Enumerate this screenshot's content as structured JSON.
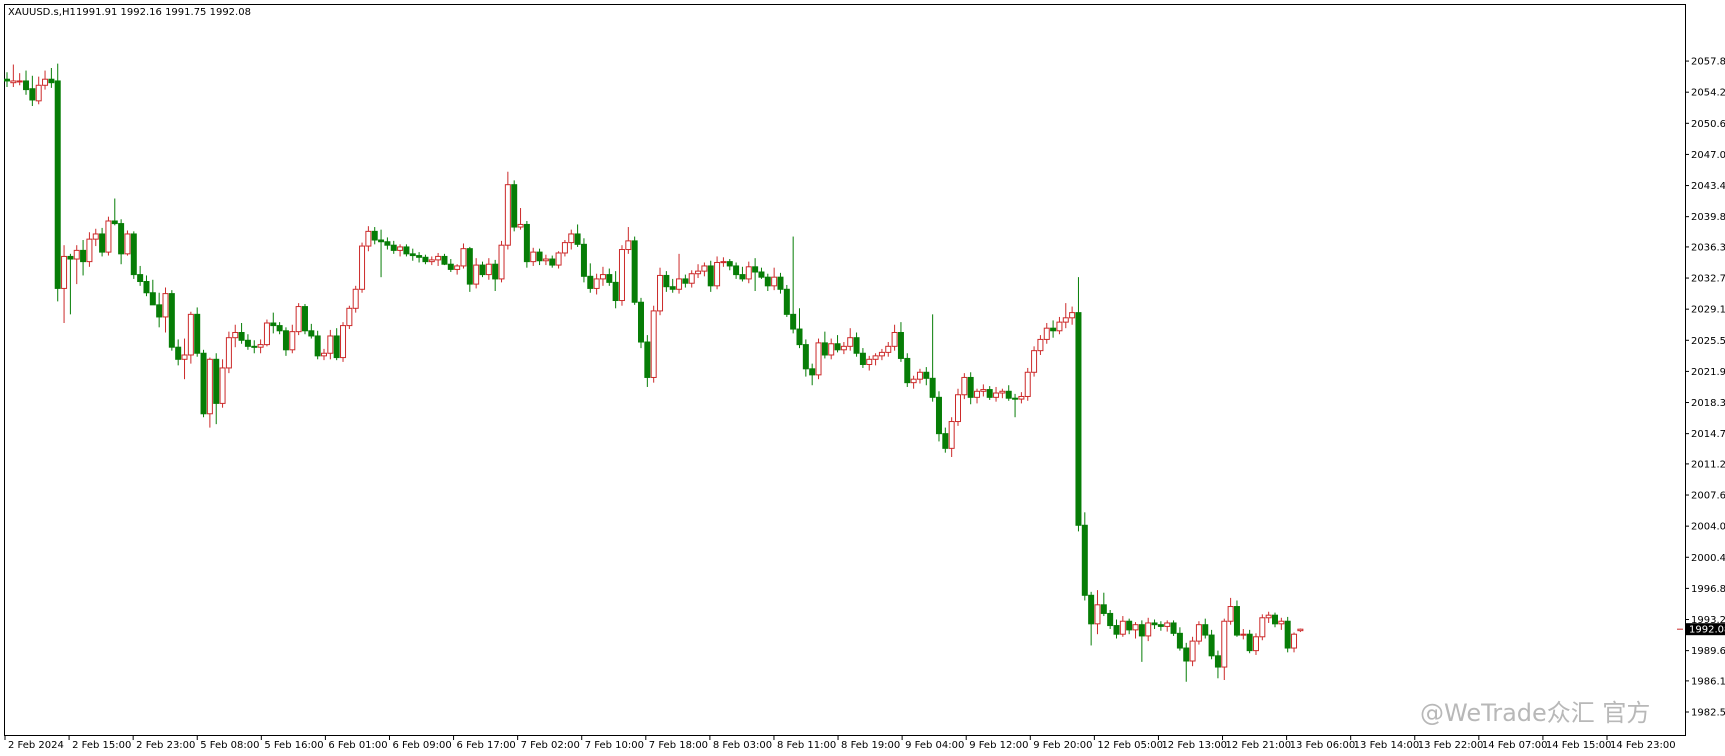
{
  "header": {
    "symbol_label": "XAUUSD.s,H1",
    "ohlc_label": "1991.91 1992.16 1991.75 1992.08"
  },
  "watermark": {
    "text": "@WeTrade众汇 官方"
  },
  "colors": {
    "background": "#ffffff",
    "bull": "#cc2a2a",
    "bear": "#067d06",
    "axis": "#000000",
    "price_tag_bg": "#000000",
    "price_tag_text": "#ffffff"
  },
  "chart_data": {
    "type": "candlestick",
    "title": "XAUUSD.s,H1",
    "timeframe": "H1",
    "grid": false,
    "ylim": [
      1982.5,
      2060.7
    ],
    "y_ticks": [
      "2057.80",
      "2054.20",
      "2050.60",
      "2047.00",
      "2043.40",
      "2039.80",
      "2036.30",
      "2032.70",
      "2029.10",
      "2025.50",
      "2021.90",
      "2018.30",
      "2014.70",
      "2011.20",
      "2007.60",
      "2004.00",
      "2000.40",
      "1996.80",
      "1993.20",
      "1989.60",
      "1986.10",
      "1982.50"
    ],
    "x_labels": [
      "2 Feb 2024",
      "2 Feb 15:00",
      "2 Feb 23:00",
      "5 Feb 08:00",
      "5 Feb 16:00",
      "6 Feb 01:00",
      "6 Feb 09:00",
      "6 Feb 17:00",
      "7 Feb 02:00",
      "7 Feb 10:00",
      "7 Feb 18:00",
      "8 Feb 03:00",
      "8 Feb 11:00",
      "8 Feb 19:00",
      "9 Feb 04:00",
      "9 Feb 12:00",
      "9 Feb 20:00",
      "12 Feb 05:00",
      "12 Feb 13:00",
      "12 Feb 21:00",
      "13 Feb 06:00",
      "13 Feb 14:00",
      "13 Feb 22:00",
      "14 Feb 07:00",
      "14 Feb 15:00",
      "14 Feb 23:00"
    ],
    "current_price": "1992.08",
    "candles": [
      [
        2055.7,
        2056.5,
        2054.8,
        2055.5
      ],
      [
        2055.3,
        2057.4,
        2054.8,
        2055.5
      ],
      [
        2055.4,
        2056.4,
        2055.0,
        2055.5
      ],
      [
        2055.5,
        2056.7,
        2053.9,
        2054.5
      ],
      [
        2054.6,
        2056.1,
        2052.6,
        2053.3
      ],
      [
        2053.2,
        2056.0,
        2052.8,
        2055.0
      ],
      [
        2055.0,
        2056.7,
        2054.5,
        2055.7
      ],
      [
        2055.7,
        2057.0,
        2054.7,
        2055.3
      ],
      [
        2055.5,
        2057.5,
        2030.0,
        2031.5
      ],
      [
        2031.5,
        2036.5,
        2027.5,
        2035.2
      ],
      [
        2035.2,
        2035.5,
        2028.5,
        2034.9
      ],
      [
        2034.9,
        2036.5,
        2032.0,
        2035.9
      ],
      [
        2035.9,
        2037.1,
        2033.0,
        2034.6
      ],
      [
        2034.6,
        2038.0,
        2034.0,
        2037.2
      ],
      [
        2037.2,
        2038.4,
        2036.4,
        2037.8
      ],
      [
        2037.8,
        2038.5,
        2035.2,
        2035.7
      ],
      [
        2035.7,
        2039.8,
        2035.3,
        2039.3
      ],
      [
        2039.3,
        2041.9,
        2038.8,
        2039.0
      ],
      [
        2039.0,
        2039.5,
        2034.3,
        2035.5
      ],
      [
        2035.5,
        2038.2,
        2035.3,
        2037.8
      ],
      [
        2037.8,
        2038.1,
        2032.6,
        2033.1
      ],
      [
        2033.1,
        2034.1,
        2031.8,
        2032.3
      ],
      [
        2032.3,
        2033.0,
        2030.6,
        2031.0
      ],
      [
        2031.0,
        2032.5,
        2029.6,
        2029.6
      ],
      [
        2029.6,
        2031.0,
        2027.0,
        2028.2
      ],
      [
        2028.2,
        2031.6,
        2026.4,
        2030.9
      ],
      [
        2030.9,
        2031.3,
        2024.3,
        2024.7
      ],
      [
        2024.7,
        2025.6,
        2022.6,
        2023.3
      ],
      [
        2023.3,
        2025.7,
        2021.0,
        2023.8
      ],
      [
        2023.8,
        2028.8,
        2022.8,
        2028.5
      ],
      [
        2028.5,
        2029.3,
        2023.6,
        2024.0
      ],
      [
        2024.0,
        2024.4,
        2016.6,
        2017.0
      ],
      [
        2017.0,
        2023.5,
        2015.4,
        2023.3
      ],
      [
        2023.3,
        2024.0,
        2015.8,
        2018.2
      ],
      [
        2018.2,
        2023.3,
        2017.7,
        2022.3
      ],
      [
        2022.3,
        2026.5,
        2021.7,
        2025.8
      ],
      [
        2025.8,
        2027.3,
        2024.7,
        2026.4
      ],
      [
        2026.4,
        2027.5,
        2025.1,
        2025.5
      ],
      [
        2025.5,
        2026.2,
        2024.4,
        2024.8
      ],
      [
        2024.8,
        2025.5,
        2024.0,
        2024.7
      ],
      [
        2024.7,
        2025.6,
        2024.0,
        2025.0
      ],
      [
        2025.0,
        2027.9,
        2024.8,
        2027.5
      ],
      [
        2027.5,
        2028.7,
        2026.3,
        2027.2
      ],
      [
        2027.2,
        2027.6,
        2026.2,
        2026.6
      ],
      [
        2026.6,
        2027.0,
        2023.7,
        2024.4
      ],
      [
        2024.4,
        2027.3,
        2024.0,
        2026.5
      ],
      [
        2026.5,
        2029.8,
        2026.1,
        2029.4
      ],
      [
        2029.4,
        2029.7,
        2026.2,
        2026.6
      ],
      [
        2026.6,
        2027.4,
        2025.7,
        2026.0
      ],
      [
        2026.0,
        2026.6,
        2023.3,
        2023.7
      ],
      [
        2023.7,
        2024.5,
        2023.2,
        2024.0
      ],
      [
        2024.0,
        2026.7,
        2023.3,
        2026.0
      ],
      [
        2026.0,
        2026.9,
        2023.2,
        2023.5
      ],
      [
        2023.5,
        2027.6,
        2023.0,
        2027.2
      ],
      [
        2027.2,
        2029.5,
        2026.8,
        2029.2
      ],
      [
        2029.2,
        2031.8,
        2028.7,
        2031.4
      ],
      [
        2031.4,
        2036.8,
        2031.0,
        2036.4
      ],
      [
        2036.4,
        2038.7,
        2035.8,
        2038.1
      ],
      [
        2038.1,
        2038.6,
        2036.6,
        2037.1
      ],
      [
        2037.1,
        2038.3,
        2032.8,
        2036.9
      ],
      [
        2036.9,
        2037.4,
        2036.0,
        2036.5
      ],
      [
        2036.5,
        2037.0,
        2035.5,
        2035.9
      ],
      [
        2035.9,
        2036.6,
        2035.2,
        2036.3
      ],
      [
        2036.3,
        2036.6,
        2035.2,
        2035.5
      ],
      [
        2035.5,
        2036.1,
        2034.7,
        2035.3
      ],
      [
        2035.3,
        2035.7,
        2034.5,
        2035.1
      ],
      [
        2035.1,
        2035.4,
        2034.3,
        2034.6
      ],
      [
        2034.6,
        2035.2,
        2034.2,
        2034.8
      ],
      [
        2034.8,
        2035.6,
        2034.1,
        2035.2
      ],
      [
        2035.2,
        2035.5,
        2034.2,
        2034.3
      ],
      [
        2034.3,
        2034.9,
        2033.4,
        2033.7
      ],
      [
        2033.7,
        2034.3,
        2033.1,
        2034.1
      ],
      [
        2034.1,
        2036.7,
        2033.8,
        2036.1
      ],
      [
        2036.1,
        2036.3,
        2031.1,
        2032.0
      ],
      [
        2032.0,
        2035.0,
        2031.5,
        2034.2
      ],
      [
        2034.2,
        2034.6,
        2032.8,
        2033.1
      ],
      [
        2033.1,
        2035.0,
        2032.5,
        2034.3
      ],
      [
        2034.3,
        2034.8,
        2031.2,
        2032.6
      ],
      [
        2032.6,
        2037.0,
        2032.2,
        2036.5
      ],
      [
        2036.5,
        2045.0,
        2036.0,
        2043.5
      ],
      [
        2043.5,
        2044.0,
        2038.1,
        2038.6
      ],
      [
        2038.6,
        2040.8,
        2038.3,
        2038.9
      ],
      [
        2038.9,
        2039.3,
        2033.9,
        2034.6
      ],
      [
        2034.6,
        2036.2,
        2034.1,
        2035.7
      ],
      [
        2035.7,
        2036.1,
        2034.2,
        2034.7
      ],
      [
        2034.7,
        2035.4,
        2034.2,
        2034.9
      ],
      [
        2034.9,
        2035.3,
        2033.9,
        2034.2
      ],
      [
        2034.2,
        2035.8,
        2033.8,
        2035.6
      ],
      [
        2035.6,
        2037.1,
        2035.2,
        2036.8
      ],
      [
        2036.8,
        2038.3,
        2036.0,
        2037.8
      ],
      [
        2037.8,
        2038.9,
        2036.3,
        2036.6
      ],
      [
        2036.6,
        2037.3,
        2032.2,
        2032.9
      ],
      [
        2032.9,
        2034.4,
        2031.0,
        2031.5
      ],
      [
        2031.5,
        2033.2,
        2030.8,
        2032.6
      ],
      [
        2032.6,
        2034.0,
        2031.8,
        2033.1
      ],
      [
        2033.1,
        2033.8,
        2031.8,
        2032.2
      ],
      [
        2032.2,
        2033.5,
        2029.2,
        2030.1
      ],
      [
        2030.1,
        2036.5,
        2029.5,
        2036.0
      ],
      [
        2036.0,
        2038.6,
        2035.5,
        2037.0
      ],
      [
        2037.0,
        2037.5,
        2029.6,
        2029.9
      ],
      [
        2029.9,
        2030.4,
        2024.6,
        2025.3
      ],
      [
        2025.3,
        2026.1,
        2020.1,
        2021.2
      ],
      [
        2021.2,
        2029.5,
        2020.6,
        2028.9
      ],
      [
        2028.9,
        2033.9,
        2028.4,
        2033.0
      ],
      [
        2033.0,
        2033.5,
        2031.1,
        2031.7
      ],
      [
        2031.7,
        2032.6,
        2031.0,
        2031.4
      ],
      [
        2031.4,
        2035.5,
        2030.9,
        2032.6
      ],
      [
        2032.6,
        2033.1,
        2031.6,
        2032.1
      ],
      [
        2032.1,
        2033.6,
        2031.6,
        2033.2
      ],
      [
        2033.2,
        2034.3,
        2032.7,
        2033.5
      ],
      [
        2033.5,
        2034.5,
        2032.9,
        2034.1
      ],
      [
        2034.1,
        2034.7,
        2031.1,
        2031.8
      ],
      [
        2031.8,
        2035.2,
        2031.4,
        2034.5
      ],
      [
        2034.5,
        2035.1,
        2034.0,
        2034.6
      ],
      [
        2034.6,
        2034.9,
        2033.6,
        2034.1
      ],
      [
        2034.1,
        2034.5,
        2032.6,
        2033.1
      ],
      [
        2033.1,
        2034.0,
        2032.3,
        2032.6
      ],
      [
        2032.6,
        2034.6,
        2032.1,
        2034.0
      ],
      [
        2034.0,
        2035.0,
        2031.2,
        2033.4
      ],
      [
        2033.4,
        2033.9,
        2032.6,
        2032.8
      ],
      [
        2032.8,
        2033.2,
        2031.2,
        2031.8
      ],
      [
        2031.8,
        2033.9,
        2031.3,
        2032.8
      ],
      [
        2032.8,
        2033.3,
        2030.9,
        2031.4
      ],
      [
        2031.4,
        2031.9,
        2028.2,
        2028.5
      ],
      [
        2028.5,
        2037.5,
        2026.3,
        2026.8
      ],
      [
        2026.8,
        2029.2,
        2024.6,
        2025.0
      ],
      [
        2025.0,
        2025.6,
        2021.3,
        2022.2
      ],
      [
        2022.2,
        2022.8,
        2020.3,
        2021.5
      ],
      [
        2021.5,
        2025.7,
        2021.0,
        2025.2
      ],
      [
        2025.2,
        2026.5,
        2023.4,
        2023.8
      ],
      [
        2023.8,
        2025.7,
        2023.3,
        2025.1
      ],
      [
        2025.1,
        2026.1,
        2024.1,
        2024.4
      ],
      [
        2024.4,
        2025.3,
        2023.9,
        2024.8
      ],
      [
        2024.8,
        2026.9,
        2024.3,
        2025.8
      ],
      [
        2025.8,
        2026.4,
        2023.6,
        2024.0
      ],
      [
        2024.0,
        2024.6,
        2022.3,
        2022.7
      ],
      [
        2022.7,
        2023.7,
        2022.0,
        2023.3
      ],
      [
        2023.3,
        2024.0,
        2022.6,
        2023.7
      ],
      [
        2023.7,
        2024.5,
        2023.2,
        2024.1
      ],
      [
        2024.1,
        2025.3,
        2023.6,
        2024.8
      ],
      [
        2024.8,
        2027.3,
        2024.3,
        2026.4
      ],
      [
        2026.4,
        2027.6,
        2023.0,
        2023.4
      ],
      [
        2023.4,
        2024.0,
        2020.1,
        2020.6
      ],
      [
        2020.6,
        2021.4,
        2019.9,
        2021.0
      ],
      [
        2021.0,
        2022.2,
        2020.5,
        2021.8
      ],
      [
        2021.8,
        2022.4,
        2020.3,
        2021.1
      ],
      [
        2021.1,
        2028.5,
        2018.4,
        2018.9
      ],
      [
        2018.9,
        2019.6,
        2013.8,
        2014.7
      ],
      [
        2014.7,
        2015.4,
        2012.5,
        2013.0
      ],
      [
        2013.0,
        2016.6,
        2012.0,
        2016.1
      ],
      [
        2016.1,
        2019.9,
        2015.6,
        2019.2
      ],
      [
        2019.2,
        2021.7,
        2018.7,
        2021.2
      ],
      [
        2021.2,
        2021.8,
        2018.1,
        2018.9
      ],
      [
        2018.9,
        2019.9,
        2018.2,
        2019.6
      ],
      [
        2019.6,
        2020.4,
        2019.0,
        2019.8
      ],
      [
        2019.8,
        2020.2,
        2018.6,
        2018.9
      ],
      [
        2018.9,
        2020.1,
        2018.4,
        2019.4
      ],
      [
        2019.4,
        2019.9,
        2018.8,
        2019.6
      ],
      [
        2019.6,
        2020.3,
        2018.5,
        2018.8
      ],
      [
        2018.8,
        2019.3,
        2016.6,
        2018.7
      ],
      [
        2018.7,
        2019.5,
        2018.2,
        2019.0
      ],
      [
        2019.0,
        2022.3,
        2018.5,
        2021.8
      ],
      [
        2021.8,
        2024.8,
        2021.3,
        2024.3
      ],
      [
        2024.3,
        2026.1,
        2023.8,
        2025.6
      ],
      [
        2025.6,
        2027.5,
        2025.1,
        2026.9
      ],
      [
        2026.9,
        2027.8,
        2025.8,
        2026.6
      ],
      [
        2026.6,
        2028.2,
        2026.2,
        2027.6
      ],
      [
        2027.6,
        2029.8,
        2026.9,
        2028.1
      ],
      [
        2028.1,
        2029.4,
        2027.3,
        2028.7
      ],
      [
        2028.7,
        2032.8,
        2003.4,
        2004.1
      ],
      [
        2004.1,
        2005.6,
        1995.4,
        1996.0
      ],
      [
        1996.0,
        1996.4,
        1990.2,
        1992.7
      ],
      [
        1992.7,
        1996.6,
        1991.5,
        1994.9
      ],
      [
        1994.9,
        1996.3,
        1993.6,
        1993.9
      ],
      [
        1993.9,
        1994.3,
        1992.1,
        1992.5
      ],
      [
        1992.5,
        1993.2,
        1991.0,
        1991.5
      ],
      [
        1991.5,
        1993.6,
        1991.2,
        1993.0
      ],
      [
        1993.0,
        1993.3,
        1991.5,
        1992.0
      ],
      [
        1992.0,
        1992.9,
        1991.0,
        1992.6
      ],
      [
        1992.6,
        1993.1,
        1988.3,
        1991.3
      ],
      [
        1991.3,
        1993.4,
        1990.7,
        1992.8
      ],
      [
        1992.8,
        1993.2,
        1992.1,
        1992.6
      ],
      [
        1992.6,
        1993.0,
        1991.9,
        1992.4
      ],
      [
        1992.4,
        1993.1,
        1991.8,
        1992.8
      ],
      [
        1992.8,
        1993.1,
        1991.3,
        1991.6
      ],
      [
        1991.6,
        1992.3,
        1989.6,
        1989.9
      ],
      [
        1989.9,
        1990.5,
        1986.0,
        1988.4
      ],
      [
        1988.4,
        1991.2,
        1987.8,
        1990.7
      ],
      [
        1990.7,
        1993.0,
        1990.3,
        1992.6
      ],
      [
        1992.6,
        1993.3,
        1991.0,
        1991.4
      ],
      [
        1991.4,
        1992.0,
        1988.6,
        1989.0
      ],
      [
        1989.0,
        1989.6,
        1986.4,
        1987.7
      ],
      [
        1987.7,
        1993.3,
        1986.2,
        1993.0
      ],
      [
        1993.0,
        1995.7,
        1992.6,
        1994.7
      ],
      [
        1994.7,
        1995.4,
        1991.2,
        1991.4
      ],
      [
        1991.4,
        1992.1,
        1990.9,
        1991.5
      ],
      [
        1991.5,
        1992.0,
        1989.3,
        1989.6
      ],
      [
        1989.6,
        1991.6,
        1989.1,
        1991.2
      ],
      [
        1991.2,
        1993.8,
        1990.8,
        1993.4
      ],
      [
        1993.4,
        1994.1,
        1992.8,
        1993.7
      ],
      [
        1993.7,
        1994.0,
        1992.3,
        1992.7
      ],
      [
        1992.7,
        1993.4,
        1992.0,
        1993.0
      ],
      [
        1993.0,
        1993.5,
        1989.4,
        1989.9
      ],
      [
        1989.9,
        1991.7,
        1989.4,
        1991.5
      ],
      [
        1991.91,
        1992.16,
        1991.75,
        1992.08
      ]
    ]
  }
}
